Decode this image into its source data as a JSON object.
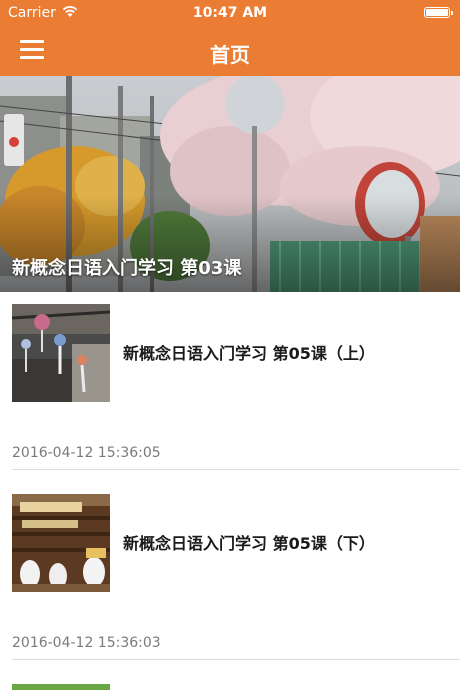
{
  "status_bar": {
    "carrier": "Carrier",
    "time": "10:47 AM"
  },
  "nav": {
    "title": "首页",
    "menu_icon": "hamburger-menu-icon"
  },
  "banner": {
    "caption": "新概念日语入门学习 第03课"
  },
  "articles": [
    {
      "title": "新概念日语入门学习 第05课（上）",
      "date": "2016-04-12 15:36:05"
    },
    {
      "title": "新概念日语入门学习 第05课（下）",
      "date": "2016-04-12 15:36:03"
    }
  ],
  "colors": {
    "accent": "#ea7d33",
    "date_text": "#7a7a7a"
  }
}
